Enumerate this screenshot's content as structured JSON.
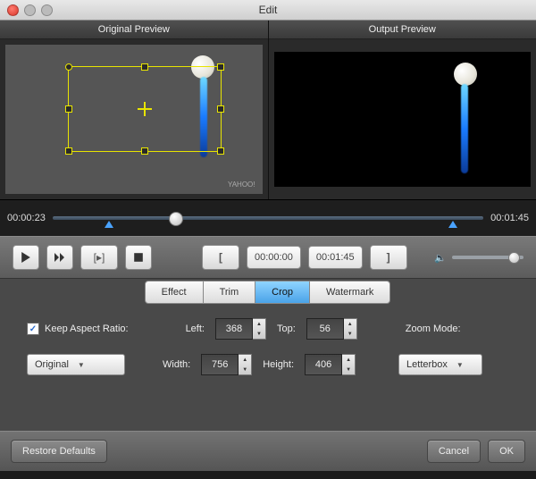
{
  "window": {
    "title": "Edit"
  },
  "previews": {
    "original_label": "Original Preview",
    "output_label": "Output Preview",
    "watermark": "YAHOO!"
  },
  "timeline": {
    "current": "00:00:23",
    "duration": "00:01:45"
  },
  "transport": {
    "trim_in": "00:00:00",
    "trim_out": "00:01:45"
  },
  "tabs": {
    "items": [
      "Effect",
      "Trim",
      "Crop",
      "Watermark"
    ],
    "active": "Crop"
  },
  "crop": {
    "keep_aspect_label": "Keep Aspect Ratio:",
    "keep_aspect_checked": true,
    "left_label": "Left:",
    "left": "368",
    "top_label": "Top:",
    "top": "56",
    "width_label": "Width:",
    "width": "756",
    "height_label": "Height:",
    "height": "406",
    "aspect_select": "Original",
    "zoom_mode_label": "Zoom Mode:",
    "zoom_mode": "Letterbox"
  },
  "footer": {
    "restore": "Restore Defaults",
    "cancel": "Cancel",
    "ok": "OK"
  }
}
